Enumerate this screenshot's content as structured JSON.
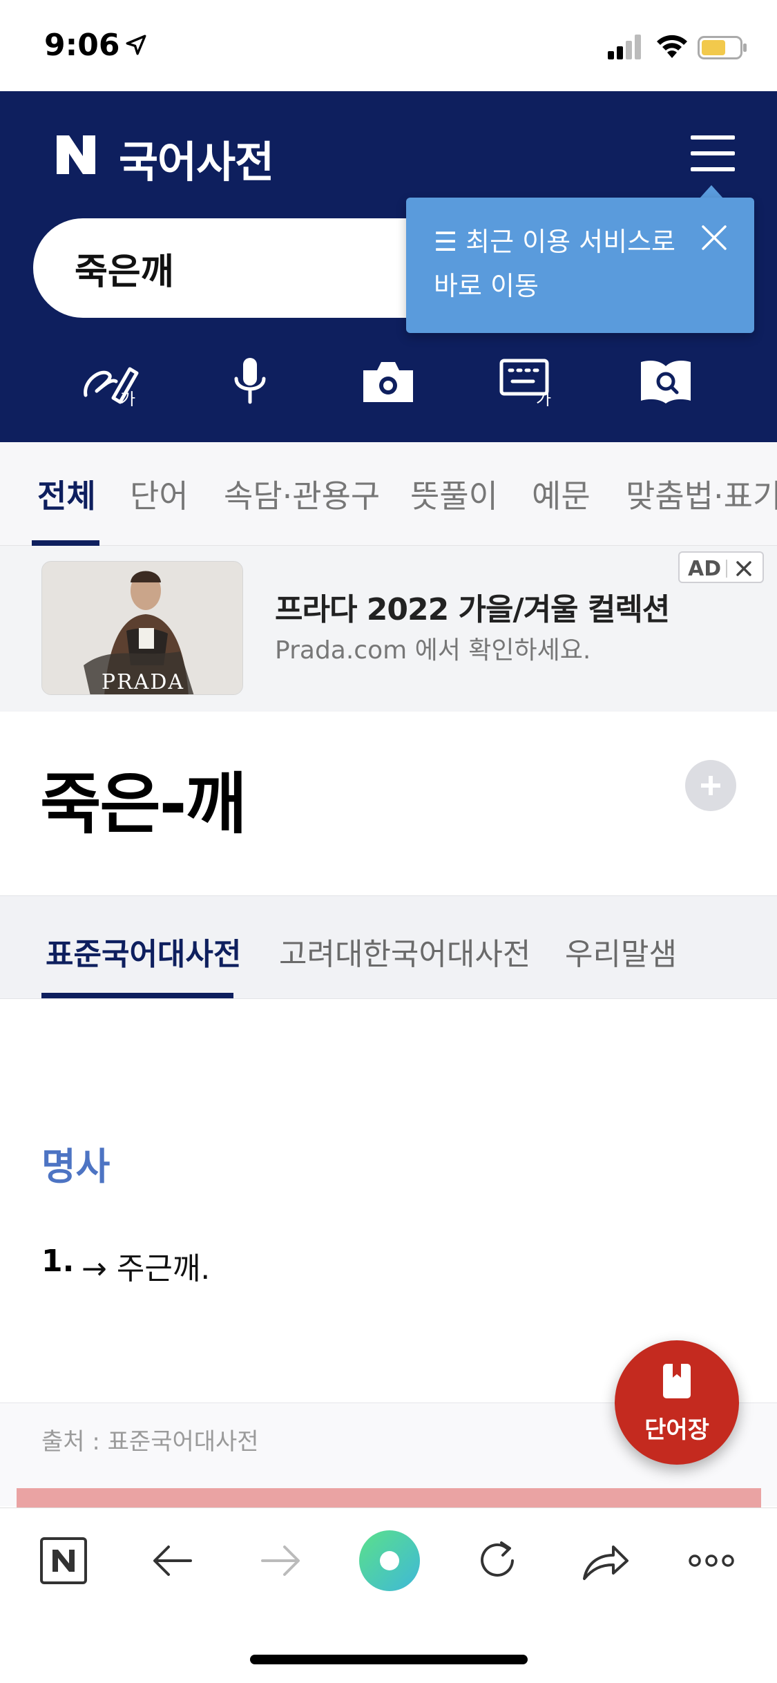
{
  "status_bar": {
    "time": "9:06"
  },
  "header": {
    "app_title": "국어사전",
    "logo_letter": "N",
    "search_value": "죽은깨",
    "tooltip_text": "☰ 최근 이용 서비스로 바로 이동",
    "tools": [
      "handwriting-icon",
      "microphone-icon",
      "camera-icon",
      "keyboard-icon",
      "dictionary-search-icon"
    ]
  },
  "tabs": [
    "전체",
    "단어",
    "속담·관용구",
    "뜻풀이",
    "예문",
    "맞춤법·표기"
  ],
  "ad": {
    "image_brand": "PRADA",
    "title": "프라다 2022 가을/겨울 컬렉션",
    "subtitle": "Prada.com 에서 확인하세요.",
    "badge": "AD"
  },
  "entry": {
    "word": "죽은-깨"
  },
  "dictionary_tabs": [
    "표준국어대사전",
    "고려대한국어대사전",
    "우리말샘"
  ],
  "definition": {
    "part_of_speech": "명사",
    "number": "1.",
    "text": "→ 주근깨."
  },
  "source": "출처 : 표준국어대사전",
  "fab": {
    "label": "단어장"
  },
  "browser_bar": [
    "naver-home-icon",
    "back-arrow-icon",
    "forward-arrow-icon",
    "green-dot-icon",
    "refresh-icon",
    "share-icon",
    "more-icon"
  ],
  "colors": {
    "header": "#0e1f5e",
    "tooltip": "#5a9bdc",
    "part_of_speech": "#4d74c3",
    "fab": "#c42a1f"
  }
}
